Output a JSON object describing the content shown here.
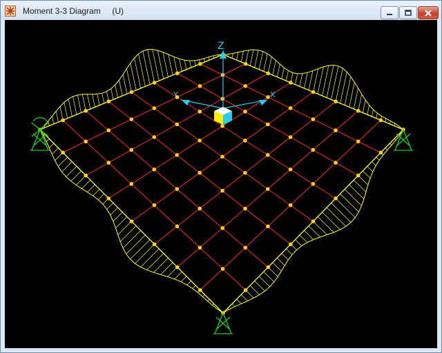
{
  "window": {
    "title": "Moment 3-3 Diagram",
    "units": "(U)",
    "controls": [
      "minimize",
      "maximize",
      "close"
    ]
  },
  "model": {
    "grid_divisions": 8,
    "grid_color": "#ff2a2a",
    "joint_color": "#ffd21e",
    "diagram_color": "#ffff33",
    "support_color": "#22cc22",
    "axis_color": "#22d0ee"
  },
  "axes": {
    "z_label": "Z",
    "y_label": "Y",
    "x_label": "X"
  },
  "icons": {
    "app": "sap-app-icon",
    "view_cube": "view-cube-icon",
    "support": "pinned-support-icon"
  }
}
